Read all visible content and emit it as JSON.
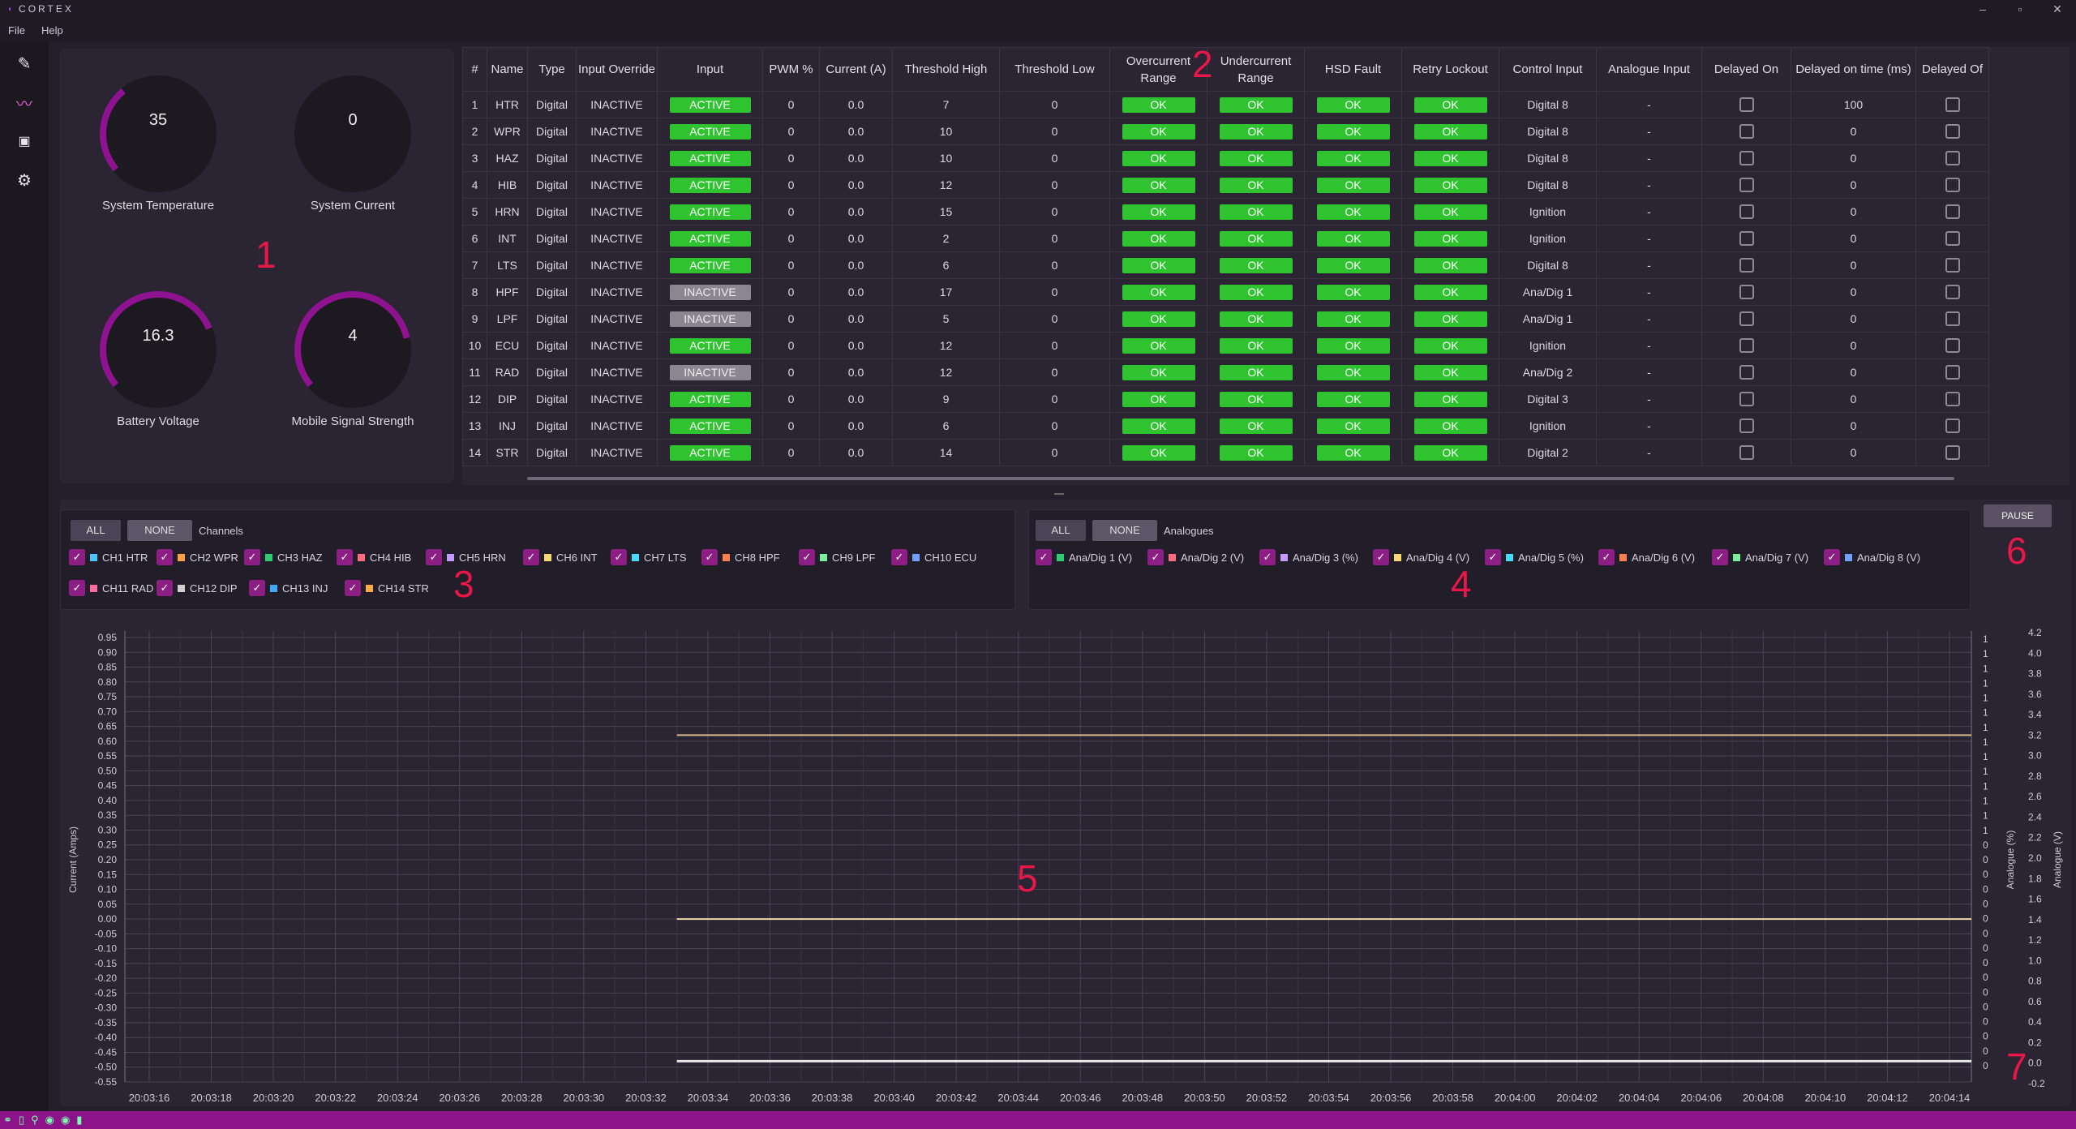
{
  "window": {
    "title": "CORTEX"
  },
  "menu": {
    "file": "File",
    "help": "Help"
  },
  "gauges": [
    {
      "value": "35",
      "label": "System Temperature",
      "fill": 0.35
    },
    {
      "value": "0",
      "label": "System Current",
      "fill": 0
    },
    {
      "value": "16.3",
      "label": "Battery Voltage",
      "fill": 0.76
    },
    {
      "value": "4",
      "label": "Mobile Signal Strength",
      "fill": 0.8
    }
  ],
  "annotations": [
    "1",
    "2",
    "3",
    "4",
    "5",
    "6",
    "7"
  ],
  "table": {
    "columns": [
      "#",
      "Name",
      "Type",
      "Input Override",
      "Input",
      "PWM %",
      "Current (A)",
      "Threshold High",
      "Threshold Low",
      "Overcurrent Range",
      "Undercurrent Range",
      "HSD Fault",
      "Retry Lockout",
      "Control Input",
      "Analogue Input",
      "Delayed On",
      "Delayed on time (ms)",
      "Delayed Of"
    ],
    "rows": [
      [
        "1",
        "HTR",
        "Digital",
        "INACTIVE",
        "ACTIVE",
        "0",
        "0.0",
        "7",
        "0",
        "OK",
        "OK",
        "OK",
        "OK",
        "Digital 8",
        "-",
        "",
        "100",
        ""
      ],
      [
        "2",
        "WPR",
        "Digital",
        "INACTIVE",
        "ACTIVE",
        "0",
        "0.0",
        "10",
        "0",
        "OK",
        "OK",
        "OK",
        "OK",
        "Digital 8",
        "-",
        "",
        "0",
        ""
      ],
      [
        "3",
        "HAZ",
        "Digital",
        "INACTIVE",
        "ACTIVE",
        "0",
        "0.0",
        "10",
        "0",
        "OK",
        "OK",
        "OK",
        "OK",
        "Digital 8",
        "-",
        "",
        "0",
        ""
      ],
      [
        "4",
        "HIB",
        "Digital",
        "INACTIVE",
        "ACTIVE",
        "0",
        "0.0",
        "12",
        "0",
        "OK",
        "OK",
        "OK",
        "OK",
        "Digital 8",
        "-",
        "",
        "0",
        ""
      ],
      [
        "5",
        "HRN",
        "Digital",
        "INACTIVE",
        "ACTIVE",
        "0",
        "0.0",
        "15",
        "0",
        "OK",
        "OK",
        "OK",
        "OK",
        "Ignition",
        "-",
        "",
        "0",
        ""
      ],
      [
        "6",
        "INT",
        "Digital",
        "INACTIVE",
        "ACTIVE",
        "0",
        "0.0",
        "2",
        "0",
        "OK",
        "OK",
        "OK",
        "OK",
        "Ignition",
        "-",
        "",
        "0",
        ""
      ],
      [
        "7",
        "LTS",
        "Digital",
        "INACTIVE",
        "ACTIVE",
        "0",
        "0.0",
        "6",
        "0",
        "OK",
        "OK",
        "OK",
        "OK",
        "Digital 8",
        "-",
        "",
        "0",
        ""
      ],
      [
        "8",
        "HPF",
        "Digital",
        "INACTIVE",
        "INACTIVE",
        "0",
        "0.0",
        "17",
        "0",
        "OK",
        "OK",
        "OK",
        "OK",
        "Ana/Dig 1",
        "-",
        "",
        "0",
        ""
      ],
      [
        "9",
        "LPF",
        "Digital",
        "INACTIVE",
        "INACTIVE",
        "0",
        "0.0",
        "5",
        "0",
        "OK",
        "OK",
        "OK",
        "OK",
        "Ana/Dig 1",
        "-",
        "",
        "0",
        ""
      ],
      [
        "10",
        "ECU",
        "Digital",
        "INACTIVE",
        "ACTIVE",
        "0",
        "0.0",
        "12",
        "0",
        "OK",
        "OK",
        "OK",
        "OK",
        "Ignition",
        "-",
        "",
        "0",
        ""
      ],
      [
        "11",
        "RAD",
        "Digital",
        "INACTIVE",
        "INACTIVE",
        "0",
        "0.0",
        "12",
        "0",
        "OK",
        "OK",
        "OK",
        "OK",
        "Ana/Dig 2",
        "-",
        "",
        "0",
        ""
      ],
      [
        "12",
        "DIP",
        "Digital",
        "INACTIVE",
        "ACTIVE",
        "0",
        "0.0",
        "9",
        "0",
        "OK",
        "OK",
        "OK",
        "OK",
        "Digital 3",
        "-",
        "",
        "0",
        ""
      ],
      [
        "13",
        "INJ",
        "Digital",
        "INACTIVE",
        "ACTIVE",
        "0",
        "0.0",
        "6",
        "0",
        "OK",
        "OK",
        "OK",
        "OK",
        "Ignition",
        "-",
        "",
        "0",
        ""
      ],
      [
        "14",
        "STR",
        "Digital",
        "INACTIVE",
        "ACTIVE",
        "0",
        "0.0",
        "14",
        "0",
        "OK",
        "OK",
        "OK",
        "OK",
        "Digital 2",
        "-",
        "",
        "0",
        ""
      ]
    ]
  },
  "channels": {
    "all": "ALL",
    "none": "NONE",
    "title": "Channels",
    "items": [
      {
        "label": "CH1 HTR",
        "color": "#4fc3f7"
      },
      {
        "label": "CH2 WPR",
        "color": "#ff9f43"
      },
      {
        "label": "CH3 HAZ",
        "color": "#2ecc71"
      },
      {
        "label": "CH4 HIB",
        "color": "#ff6b81"
      },
      {
        "label": "CH5 HRN",
        "color": "#c39bff"
      },
      {
        "label": "CH6 INT",
        "color": "#f7d774"
      },
      {
        "label": "CH7 LTS",
        "color": "#48dbfb"
      },
      {
        "label": "CH8 HPF",
        "color": "#ff7f50"
      },
      {
        "label": "CH9 LPF",
        "color": "#7bed9f"
      },
      {
        "label": "CH10 ECU",
        "color": "#70a1ff"
      },
      {
        "label": "CH11 RAD",
        "color": "#ff6b9d"
      },
      {
        "label": "CH12 DIP",
        "color": "#d0d0d0"
      },
      {
        "label": "CH13 INJ",
        "color": "#3fa9f5"
      },
      {
        "label": "CH14 STR",
        "color": "#ffa94d"
      }
    ]
  },
  "analogues": {
    "all": "ALL",
    "none": "NONE",
    "title": "Analogues",
    "items": [
      {
        "label": "Ana/Dig 1 (V)",
        "color": "#2ecc71"
      },
      {
        "label": "Ana/Dig 2 (V)",
        "color": "#ff6b81"
      },
      {
        "label": "Ana/Dig 3 (%)",
        "color": "#c39bff"
      },
      {
        "label": "Ana/Dig 4 (V)",
        "color": "#f7d774"
      },
      {
        "label": "Ana/Dig 5 (%)",
        "color": "#48dbfb"
      },
      {
        "label": "Ana/Dig 6 (V)",
        "color": "#ff7f50"
      },
      {
        "label": "Ana/Dig 7 (V)",
        "color": "#7bed9f"
      },
      {
        "label": "Ana/Dig 8 (V)",
        "color": "#70a1ff"
      }
    ]
  },
  "pause": "PAUSE",
  "chart_data": {
    "type": "line",
    "xlabel": "Time",
    "ylabel": "Current (Amps)",
    "y2label": "Analogue (%)",
    "y3label": "Analogue (V)",
    "x": [
      "20:03:16",
      "20:03:18",
      "20:03:20",
      "20:03:22",
      "20:03:24",
      "20:03:26",
      "20:03:28",
      "20:03:30",
      "20:03:32",
      "20:03:34",
      "20:03:36",
      "20:03:38",
      "20:03:40",
      "20:03:42",
      "20:03:44",
      "20:03:46",
      "20:03:48",
      "20:03:50",
      "20:03:52",
      "20:03:54",
      "20:03:56",
      "20:03:58",
      "20:04:00",
      "20:04:02",
      "20:04:04",
      "20:04:06",
      "20:04:08",
      "20:04:10",
      "20:04:12",
      "20:04:14"
    ],
    "ylim": [
      -0.55,
      0.95
    ],
    "yticks": [
      "0.95",
      "0.90",
      "0.85",
      "0.80",
      "0.75",
      "0.70",
      "0.65",
      "0.60",
      "0.55",
      "0.50",
      "0.45",
      "0.40",
      "0.35",
      "0.30",
      "0.25",
      "0.20",
      "0.15",
      "0.10",
      "0.05",
      "0.00",
      "-0.05",
      "-0.10",
      "-0.15",
      "-0.20",
      "-0.25",
      "-0.30",
      "-0.35",
      "-0.40",
      "-0.45",
      "-0.50",
      "-0.55"
    ],
    "y2ticks": [
      "1",
      "1",
      "1",
      "1",
      "1",
      "1",
      "1",
      "1",
      "1",
      "1",
      "1",
      "1",
      "1",
      "1",
      "0",
      "0",
      "0",
      "0",
      "0",
      "0",
      "0",
      "0",
      "0",
      "0",
      "0",
      "0",
      "0",
      "0",
      "0",
      "0",
      ""
    ],
    "y3ticks": [
      "4.2",
      "4.0",
      "3.8",
      "3.6",
      "3.4",
      "3.2",
      "3.0",
      "2.8",
      "2.6",
      "2.4",
      "2.2",
      "2.0",
      "1.8",
      "1.6",
      "1.4",
      "1.2",
      "1.0",
      "0.8",
      "0.6",
      "0.4",
      "0.2",
      "0.0",
      "-0.2"
    ],
    "series": [
      {
        "color": "#d9b98a",
        "start_time": "20:03:33",
        "values_voltage": 3.2
      },
      {
        "color": "#f0d9a8",
        "start_time": "20:03:33",
        "values_current": 0.0
      },
      {
        "color": "#e8e8e8",
        "start_time": "20:03:33",
        "values_current": -0.48
      }
    ]
  }
}
